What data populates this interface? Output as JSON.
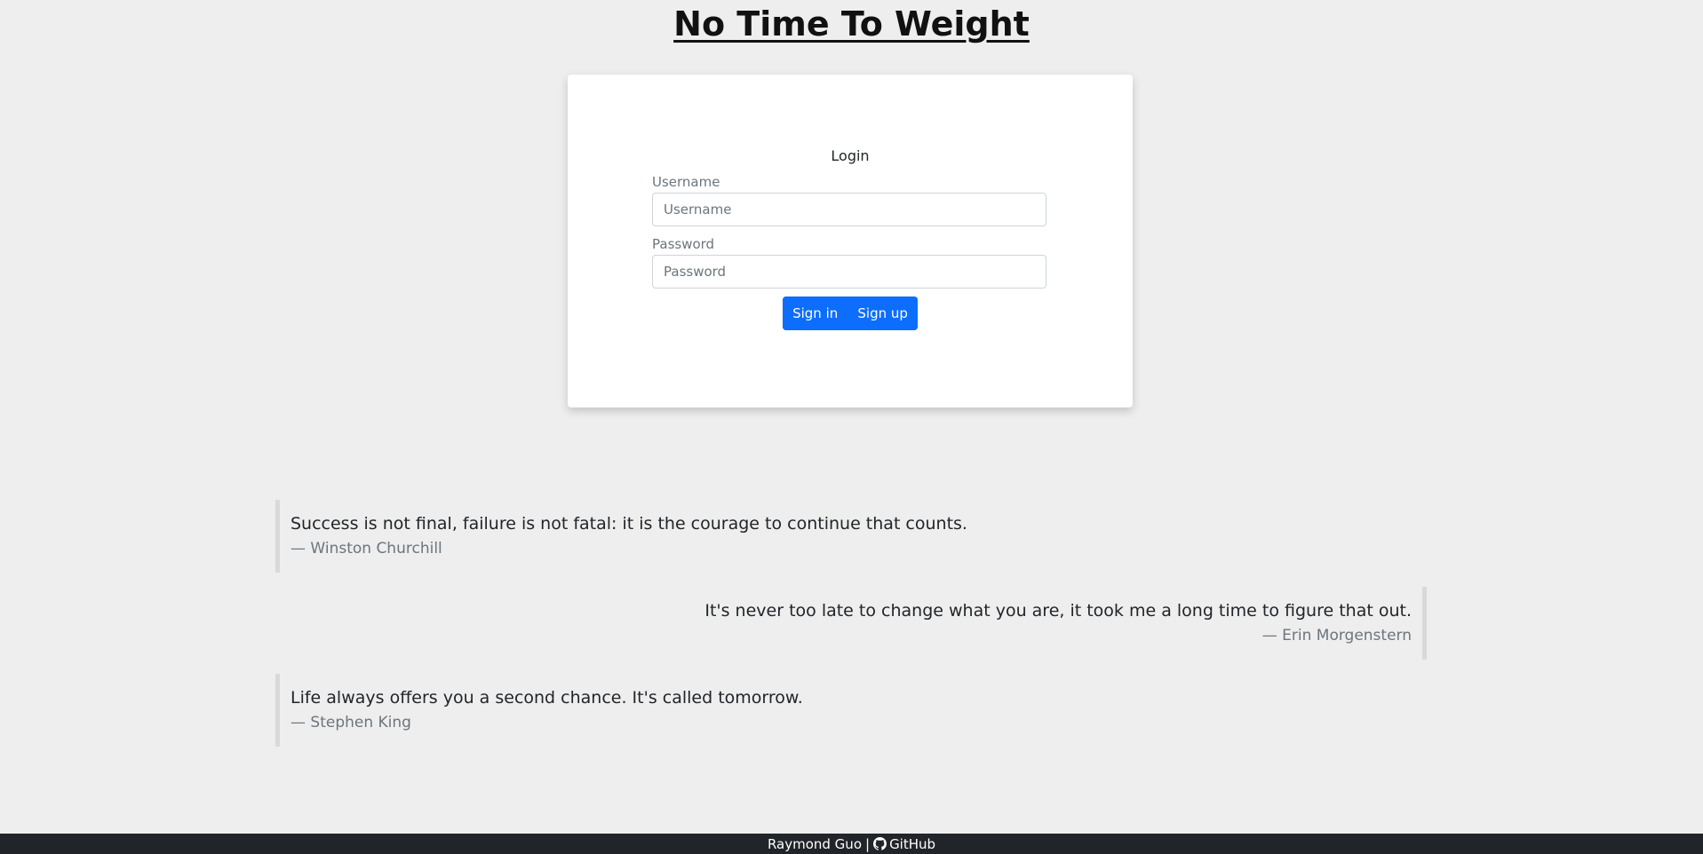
{
  "header": {
    "title": "No Time To Weight"
  },
  "login": {
    "heading": "Login",
    "username_label": "Username",
    "username_placeholder": "Username",
    "password_label": "Password",
    "password_placeholder": "Password",
    "sign_in_label": "Sign in",
    "sign_up_label": "Sign up"
  },
  "quotes": [
    {
      "text": "Success is not final, failure is not fatal: it is the courage to continue that counts.",
      "author": "— Winston Churchill",
      "align": "left"
    },
    {
      "text": "It's never too late to change what you are, it took me a long time to figure that out.",
      "author": "— Erin Morgenstern",
      "align": "right"
    },
    {
      "text": "Life always offers you a second chance. It's called tomorrow.",
      "author": "— Stephen King",
      "align": "left"
    }
  ],
  "footer": {
    "author": "Raymond Guo",
    "separator": "|",
    "github_label": "GitHub",
    "github_icon": "github-icon"
  },
  "colors": {
    "background": "#eeeeee",
    "primary": "#0d6efd",
    "footer_bg": "#212529"
  }
}
